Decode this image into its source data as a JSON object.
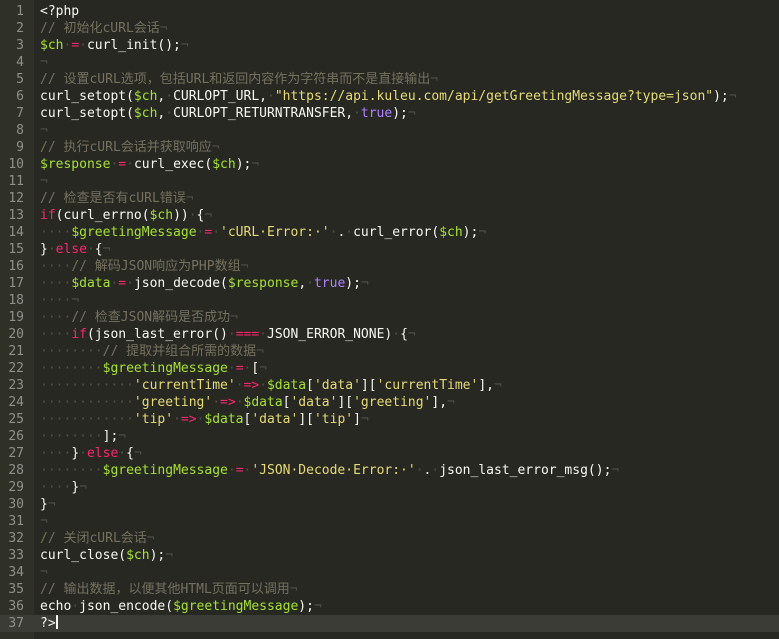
{
  "editor": {
    "lines": [
      {
        "n": "1",
        "tokens": [
          [
            "t",
            "<?php"
          ]
        ]
      },
      {
        "n": "2",
        "tokens": [
          [
            "c",
            "// 初始化cURL会话"
          ],
          [
            "ws",
            "¬"
          ]
        ]
      },
      {
        "n": "3",
        "tokens": [
          [
            "v",
            "$ch"
          ],
          [
            "ws",
            "·"
          ],
          [
            "o",
            "="
          ],
          [
            "ws",
            "·"
          ],
          [
            "t",
            "curl_init();"
          ],
          [
            "ws",
            "¬"
          ]
        ]
      },
      {
        "n": "4",
        "tokens": [
          [
            "ws",
            "¬"
          ]
        ]
      },
      {
        "n": "5",
        "tokens": [
          [
            "c",
            "// 设置cURL选项，包括URL和返回内容作为字符串而不是直接输出"
          ],
          [
            "ws",
            "¬"
          ]
        ]
      },
      {
        "n": "6",
        "tokens": [
          [
            "t",
            "curl_setopt("
          ],
          [
            "v",
            "$ch"
          ],
          [
            "t",
            ","
          ],
          [
            "ws",
            "·"
          ],
          [
            "t",
            "CURLOPT_URL,"
          ],
          [
            "ws",
            "·"
          ],
          [
            "s",
            "\"https://api.kuleu.com/api/getGreetingMessage?type=json\""
          ],
          [
            "t",
            ");"
          ],
          [
            "ws",
            "¬"
          ]
        ]
      },
      {
        "n": "7",
        "tokens": [
          [
            "t",
            "curl_setopt("
          ],
          [
            "v",
            "$ch"
          ],
          [
            "t",
            ","
          ],
          [
            "ws",
            "·"
          ],
          [
            "t",
            "CURLOPT_RETURNTRANSFER,"
          ],
          [
            "ws",
            "·"
          ],
          [
            "n",
            "true"
          ],
          [
            "t",
            ");"
          ],
          [
            "ws",
            "¬"
          ]
        ]
      },
      {
        "n": "8",
        "tokens": [
          [
            "ws",
            "¬"
          ]
        ]
      },
      {
        "n": "9",
        "tokens": [
          [
            "c",
            "// 执行cURL会话并获取响应"
          ],
          [
            "ws",
            "¬"
          ]
        ]
      },
      {
        "n": "10",
        "tokens": [
          [
            "v",
            "$response"
          ],
          [
            "ws",
            "·"
          ],
          [
            "o",
            "="
          ],
          [
            "ws",
            "·"
          ],
          [
            "t",
            "curl_exec("
          ],
          [
            "v",
            "$ch"
          ],
          [
            "t",
            ");"
          ],
          [
            "ws",
            "¬"
          ]
        ]
      },
      {
        "n": "11",
        "tokens": [
          [
            "ws",
            "¬"
          ]
        ]
      },
      {
        "n": "12",
        "tokens": [
          [
            "c",
            "// 检查是否有cURL错误"
          ],
          [
            "ws",
            "¬"
          ]
        ]
      },
      {
        "n": "13",
        "tokens": [
          [
            "o",
            "if"
          ],
          [
            "t",
            "(curl_errno("
          ],
          [
            "v",
            "$ch"
          ],
          [
            "t",
            "))"
          ],
          [
            "ws",
            "·"
          ],
          [
            "t",
            "{"
          ],
          [
            "ws",
            "¬"
          ]
        ]
      },
      {
        "n": "14",
        "tokens": [
          [
            "ws",
            "····"
          ],
          [
            "v",
            "$greetingMessage"
          ],
          [
            "ws",
            "·"
          ],
          [
            "o",
            "="
          ],
          [
            "ws",
            "·"
          ],
          [
            "s",
            "'cURL·Error:·'"
          ],
          [
            "ws",
            "·"
          ],
          [
            "t",
            "."
          ],
          [
            "ws",
            "·"
          ],
          [
            "t",
            "curl_error("
          ],
          [
            "v",
            "$ch"
          ],
          [
            "t",
            ");"
          ],
          [
            "ws",
            "¬"
          ]
        ]
      },
      {
        "n": "15",
        "tokens": [
          [
            "t",
            "}"
          ],
          [
            "ws",
            "·"
          ],
          [
            "o",
            "else"
          ],
          [
            "ws",
            "·"
          ],
          [
            "t",
            "{"
          ],
          [
            "ws",
            "¬"
          ]
        ]
      },
      {
        "n": "16",
        "tokens": [
          [
            "ws",
            "····"
          ],
          [
            "c",
            "// 解码JSON响应为PHP数组"
          ],
          [
            "ws",
            "¬"
          ]
        ]
      },
      {
        "n": "17",
        "tokens": [
          [
            "ws",
            "····"
          ],
          [
            "v",
            "$data"
          ],
          [
            "ws",
            "·"
          ],
          [
            "o",
            "="
          ],
          [
            "ws",
            "·"
          ],
          [
            "t",
            "json_decode("
          ],
          [
            "v",
            "$response"
          ],
          [
            "t",
            ","
          ],
          [
            "ws",
            "·"
          ],
          [
            "n",
            "true"
          ],
          [
            "t",
            ");"
          ],
          [
            "ws",
            "¬"
          ]
        ]
      },
      {
        "n": "18",
        "tokens": [
          [
            "ws",
            "····¬"
          ]
        ]
      },
      {
        "n": "19",
        "tokens": [
          [
            "ws",
            "····"
          ],
          [
            "c",
            "// 检查JSON解码是否成功"
          ],
          [
            "ws",
            "¬"
          ]
        ]
      },
      {
        "n": "20",
        "tokens": [
          [
            "ws",
            "····"
          ],
          [
            "o",
            "if"
          ],
          [
            "t",
            "(json_last_error()"
          ],
          [
            "ws",
            "·"
          ],
          [
            "o",
            "==="
          ],
          [
            "ws",
            "·"
          ],
          [
            "t",
            "JSON_ERROR_NONE)"
          ],
          [
            "ws",
            "·"
          ],
          [
            "t",
            "{"
          ],
          [
            "ws",
            "¬"
          ]
        ]
      },
      {
        "n": "21",
        "tokens": [
          [
            "ws",
            "········"
          ],
          [
            "c",
            "// 提取并组合所需的数据"
          ],
          [
            "ws",
            "¬"
          ]
        ]
      },
      {
        "n": "22",
        "tokens": [
          [
            "ws",
            "········"
          ],
          [
            "v",
            "$greetingMessage"
          ],
          [
            "ws",
            "·"
          ],
          [
            "o",
            "="
          ],
          [
            "ws",
            "·"
          ],
          [
            "t",
            "["
          ],
          [
            "ws",
            "¬"
          ]
        ]
      },
      {
        "n": "23",
        "tokens": [
          [
            "ws",
            "············"
          ],
          [
            "s",
            "'currentTime'"
          ],
          [
            "ws",
            "·"
          ],
          [
            "o",
            "=>"
          ],
          [
            "ws",
            "·"
          ],
          [
            "v",
            "$data"
          ],
          [
            "t",
            "["
          ],
          [
            "s",
            "'data'"
          ],
          [
            "t",
            "]["
          ],
          [
            "s",
            "'currentTime'"
          ],
          [
            "t",
            "],"
          ],
          [
            "ws",
            "¬"
          ]
        ]
      },
      {
        "n": "24",
        "tokens": [
          [
            "ws",
            "············"
          ],
          [
            "s",
            "'greeting'"
          ],
          [
            "ws",
            "·"
          ],
          [
            "o",
            "=>"
          ],
          [
            "ws",
            "·"
          ],
          [
            "v",
            "$data"
          ],
          [
            "t",
            "["
          ],
          [
            "s",
            "'data'"
          ],
          [
            "t",
            "]["
          ],
          [
            "s",
            "'greeting'"
          ],
          [
            "t",
            "],"
          ],
          [
            "ws",
            "¬"
          ]
        ]
      },
      {
        "n": "25",
        "tokens": [
          [
            "ws",
            "············"
          ],
          [
            "s",
            "'tip'"
          ],
          [
            "ws",
            "·"
          ],
          [
            "o",
            "=>"
          ],
          [
            "ws",
            "·"
          ],
          [
            "v",
            "$data"
          ],
          [
            "t",
            "["
          ],
          [
            "s",
            "'data'"
          ],
          [
            "t",
            "]["
          ],
          [
            "s",
            "'tip'"
          ],
          [
            "t",
            "]"
          ],
          [
            "ws",
            "¬"
          ]
        ]
      },
      {
        "n": "26",
        "tokens": [
          [
            "ws",
            "········"
          ],
          [
            "t",
            "];"
          ],
          [
            "ws",
            "¬"
          ]
        ]
      },
      {
        "n": "27",
        "tokens": [
          [
            "ws",
            "····"
          ],
          [
            "t",
            "}"
          ],
          [
            "ws",
            "·"
          ],
          [
            "o",
            "else"
          ],
          [
            "ws",
            "·"
          ],
          [
            "t",
            "{"
          ],
          [
            "ws",
            "¬"
          ]
        ]
      },
      {
        "n": "28",
        "tokens": [
          [
            "ws",
            "········"
          ],
          [
            "v",
            "$greetingMessage"
          ],
          [
            "ws",
            "·"
          ],
          [
            "o",
            "="
          ],
          [
            "ws",
            "·"
          ],
          [
            "s",
            "'JSON·Decode·Error:·'"
          ],
          [
            "ws",
            "·"
          ],
          [
            "t",
            "."
          ],
          [
            "ws",
            "·"
          ],
          [
            "t",
            "json_last_error_msg();"
          ],
          [
            "ws",
            "¬"
          ]
        ]
      },
      {
        "n": "29",
        "tokens": [
          [
            "ws",
            "····"
          ],
          [
            "t",
            "}"
          ],
          [
            "ws",
            "¬"
          ]
        ]
      },
      {
        "n": "30",
        "tokens": [
          [
            "t",
            "}"
          ],
          [
            "ws",
            "¬"
          ]
        ]
      },
      {
        "n": "31",
        "tokens": [
          [
            "ws",
            "¬"
          ]
        ]
      },
      {
        "n": "32",
        "tokens": [
          [
            "c",
            "// 关闭cURL会话"
          ],
          [
            "ws",
            "¬"
          ]
        ]
      },
      {
        "n": "33",
        "tokens": [
          [
            "t",
            "curl_close("
          ],
          [
            "v",
            "$ch"
          ],
          [
            "t",
            ");"
          ],
          [
            "ws",
            "¬"
          ]
        ]
      },
      {
        "n": "34",
        "tokens": [
          [
            "ws",
            "¬"
          ]
        ]
      },
      {
        "n": "35",
        "tokens": [
          [
            "c",
            "// 输出数据，以便其他HTML页面可以调用"
          ],
          [
            "ws",
            "¬"
          ]
        ]
      },
      {
        "n": "36",
        "tokens": [
          [
            "t",
            "echo"
          ],
          [
            "ws",
            "·"
          ],
          [
            "t",
            "json_encode("
          ],
          [
            "v",
            "$greetingMessage"
          ],
          [
            "t",
            ");"
          ],
          [
            "ws",
            "¬"
          ]
        ]
      },
      {
        "n": "37",
        "tokens": [
          [
            "t",
            "?>"
          ]
        ],
        "cursor": true
      }
    ]
  },
  "colors": {
    "background": "#272822",
    "gutter": "#2f3129",
    "current_line": "#3b3c35",
    "text": "#f8f8f2",
    "comment": "#75715e",
    "variable": "#a6e22e",
    "operator": "#f92672",
    "string": "#e6db74",
    "constant": "#ae81ff",
    "whitespace_marker": "#4f5045"
  }
}
